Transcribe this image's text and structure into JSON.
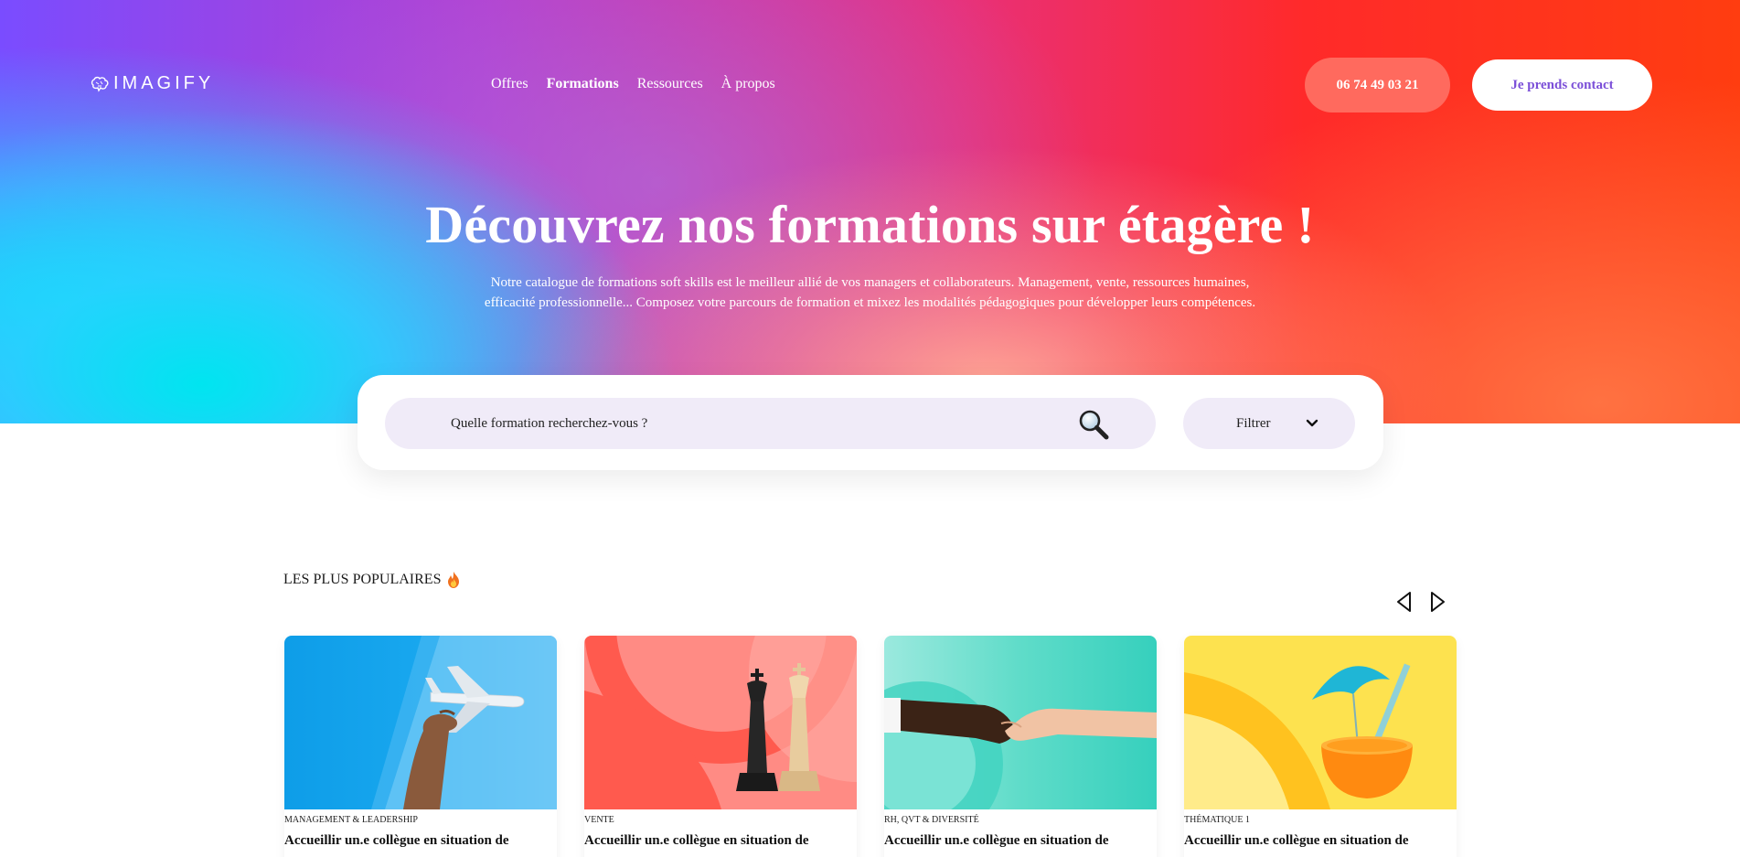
{
  "brand": {
    "name": "IMAGIFY",
    "logo_icon": "brain-icon"
  },
  "nav": {
    "items": [
      {
        "label": "Offres",
        "active": false
      },
      {
        "label": "Formations",
        "active": true
      },
      {
        "label": "Ressources",
        "active": false
      },
      {
        "label": "À propos",
        "active": false
      }
    ]
  },
  "header": {
    "phone": "06 74 49 03 21",
    "contact": "Je prends contact"
  },
  "hero": {
    "title": "Découvrez nos formations sur étagère !",
    "subtitle": "Notre catalogue de formations soft skills est le meilleur allié de vos managers et collaborateurs. Management, vente, ressources humaines, efficacité professionnelle... Composez votre parcours de formation et mixez les modalités pédagogiques pour développer leurs compétences."
  },
  "search": {
    "placeholder": "Quelle formation recherchez-vous ?",
    "filter_label": "Filtrer"
  },
  "popular": {
    "title": "LES PLUS POPULAIRES",
    "cards": [
      {
        "category": "MANAGEMENT & LEADERSHIP",
        "title": "Accueillir un.e collègue en situation de",
        "image": "airplane-hand"
      },
      {
        "category": "VENTE",
        "title": "Accueillir un.e collègue en situation de",
        "image": "chess-pieces"
      },
      {
        "category": "RH, QVT & DIVERSITÉ",
        "title": "Accueillir un.e collègue en situation de",
        "image": "handshake"
      },
      {
        "category": "THÉMATIQUE 1",
        "title": "Accueillir un.e collègue en situation de",
        "image": "orange-cocktail"
      }
    ]
  },
  "colors": {
    "accent_purple": "#7b4fd8",
    "phone_button": "#ff6a5e",
    "input_bg": "#f0ebf8"
  }
}
